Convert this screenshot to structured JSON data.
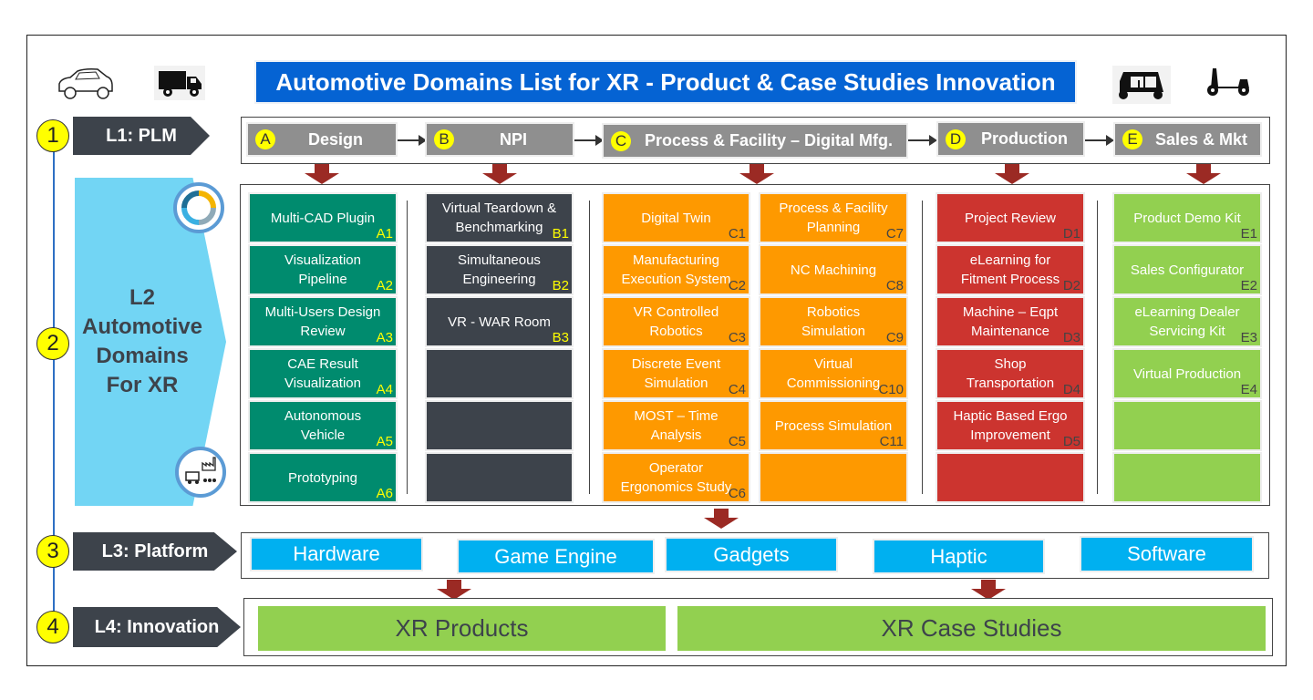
{
  "title": "Automotive Domains List for XR - Product & Case Studies Innovation",
  "vehicle_icons": [
    "car-icon",
    "truck-icon",
    "auto-rickshaw-icon",
    "scooter-icon"
  ],
  "levels": [
    {
      "number": "1",
      "label": "L1: PLM"
    },
    {
      "number": "2",
      "label": "L2 Automotive Domains For XR"
    },
    {
      "number": "3",
      "label": "L3: Platform"
    },
    {
      "number": "4",
      "label": "L4: Innovation"
    }
  ],
  "l2_label_lines": [
    "L2",
    "Automotive",
    "Domains",
    "For XR"
  ],
  "phases": [
    {
      "badge": "A",
      "label": "Design"
    },
    {
      "badge": "B",
      "label": "NPI"
    },
    {
      "badge": "C",
      "label": "Process & Facility – Digital Mfg."
    },
    {
      "badge": "D",
      "label": "Production"
    },
    {
      "badge": "E",
      "label": "Sales & Mkt"
    }
  ],
  "domains": {
    "A": [
      {
        "label": "Multi-CAD Plugin",
        "code": "A1"
      },
      {
        "label": "Visualization Pipeline",
        "code": "A2"
      },
      {
        "label": "Multi-Users Design Review",
        "code": "A3"
      },
      {
        "label": "CAE Result Visualization",
        "code": "A4"
      },
      {
        "label": "Autonomous Vehicle",
        "code": "A5"
      },
      {
        "label": "Prototyping",
        "code": "A6"
      }
    ],
    "B": [
      {
        "label": "Virtual Teardown & Benchmarking",
        "code": "B1"
      },
      {
        "label": "Simultaneous Engineering",
        "code": "B2"
      },
      {
        "label": "VR - WAR Room",
        "code": "B3"
      },
      {
        "label": "",
        "code": ""
      },
      {
        "label": "",
        "code": ""
      },
      {
        "label": "",
        "code": ""
      }
    ],
    "C_left": [
      {
        "label": "Digital Twin",
        "code": "C1"
      },
      {
        "label": "Manufacturing Execution System",
        "code": "C2"
      },
      {
        "label": "VR Controlled Robotics",
        "code": "C3"
      },
      {
        "label": "Discrete Event Simulation",
        "code": "C4"
      },
      {
        "label": "MOST – Time Analysis",
        "code": "C5"
      },
      {
        "label": "Operator Ergonomics Study",
        "code": "C6"
      }
    ],
    "C_right": [
      {
        "label": "Process & Facility Planning",
        "code": "C7"
      },
      {
        "label": "NC Machining",
        "code": "C8"
      },
      {
        "label": "Robotics Simulation",
        "code": "C9"
      },
      {
        "label": "Virtual Commissioning",
        "code": "C10"
      },
      {
        "label": "Process Simulation",
        "code": "C11"
      },
      {
        "label": "",
        "code": ""
      }
    ],
    "D": [
      {
        "label": "Project Review",
        "code": "D1"
      },
      {
        "label": "eLearning for Fitment Process",
        "code": "D2"
      },
      {
        "label": "Machine – Eqpt Maintenance",
        "code": "D3"
      },
      {
        "label": "Shop Transportation",
        "code": "D4"
      },
      {
        "label": "Haptic Based Ergo Improvement",
        "code": "D5"
      },
      {
        "label": "",
        "code": ""
      }
    ],
    "E": [
      {
        "label": "Product Demo Kit",
        "code": "E1"
      },
      {
        "label": "Sales Configurator",
        "code": "E2"
      },
      {
        "label": "eLearning Dealer Servicing Kit",
        "code": "E3"
      },
      {
        "label": "Virtual Production",
        "code": "E4"
      },
      {
        "label": "",
        "code": ""
      },
      {
        "label": "",
        "code": ""
      }
    ]
  },
  "platform": [
    "Hardware",
    "Game Engine",
    "Gadgets",
    "Haptic",
    "Software"
  ],
  "innovation": [
    "XR Products",
    "XR Case Studies"
  ],
  "colors": {
    "title_bg": "#0563d3",
    "design": "#008b6e",
    "npi": "#3d434b",
    "process": "#fe9900",
    "production": "#cc342f",
    "sales": "#92d050",
    "platform": "#00b0f0",
    "arrow": "#9b2a24",
    "badge": "#ffff00"
  }
}
